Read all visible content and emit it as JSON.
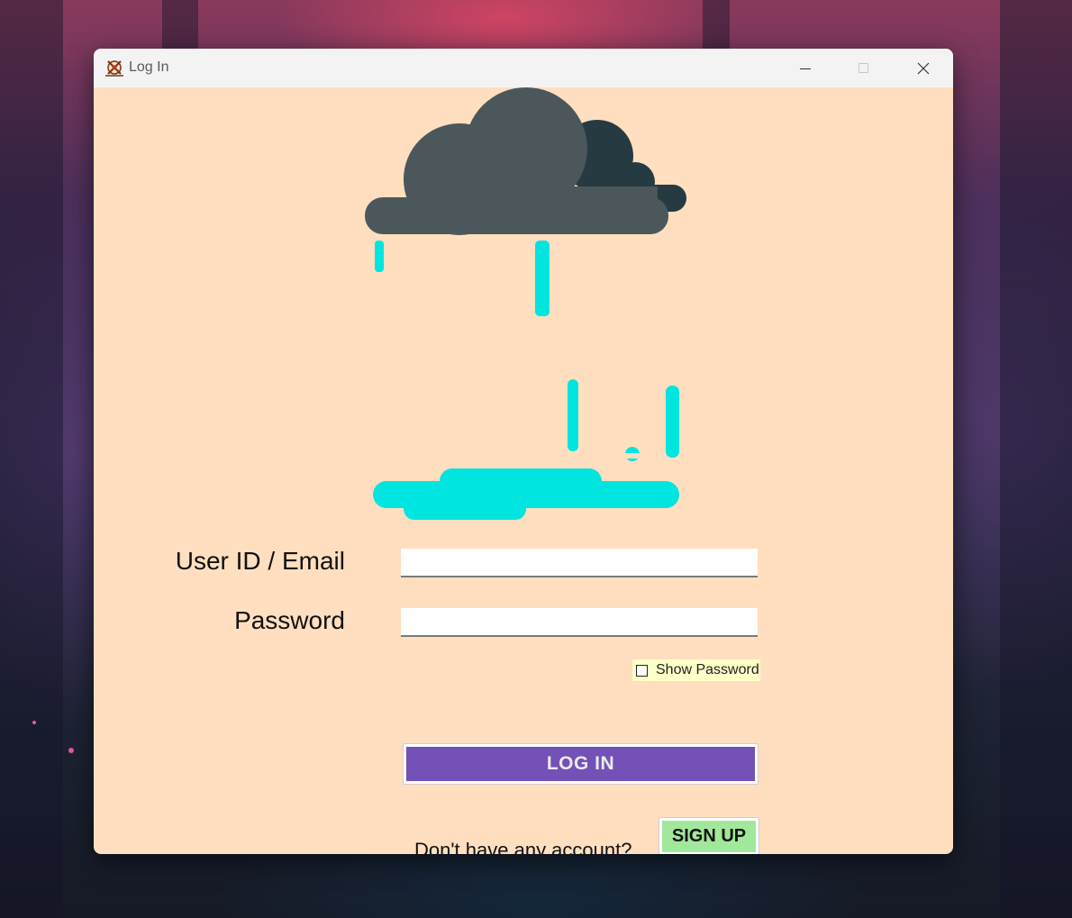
{
  "window": {
    "title": "Log In",
    "app_icon": "app-logo-icon"
  },
  "titlebar_controls": {
    "minimize_icon": "minimize-icon",
    "maximize_icon": "maximize-icon",
    "close_icon": "close-icon"
  },
  "illustration": {
    "icon": "rain-cloud-puddle-illustration",
    "colors": {
      "cloud_dark": "#4b575b",
      "cloud_shadow": "#263a42",
      "rain": "#00e5e0"
    }
  },
  "form": {
    "user_label": "User ID / Email",
    "user_value": "",
    "password_label": "Password",
    "password_value": "",
    "show_password_label": "Show Password",
    "show_password_checked": false,
    "login_label": "LOG IN",
    "no_account_text": "Don't have any account?",
    "signup_label": "SIGN UP"
  },
  "colors": {
    "window_bg": "#ffdfbf",
    "login_button": "#7351b6",
    "signup_button": "#a2e89a",
    "show_password_bg": "#ffffc8"
  }
}
